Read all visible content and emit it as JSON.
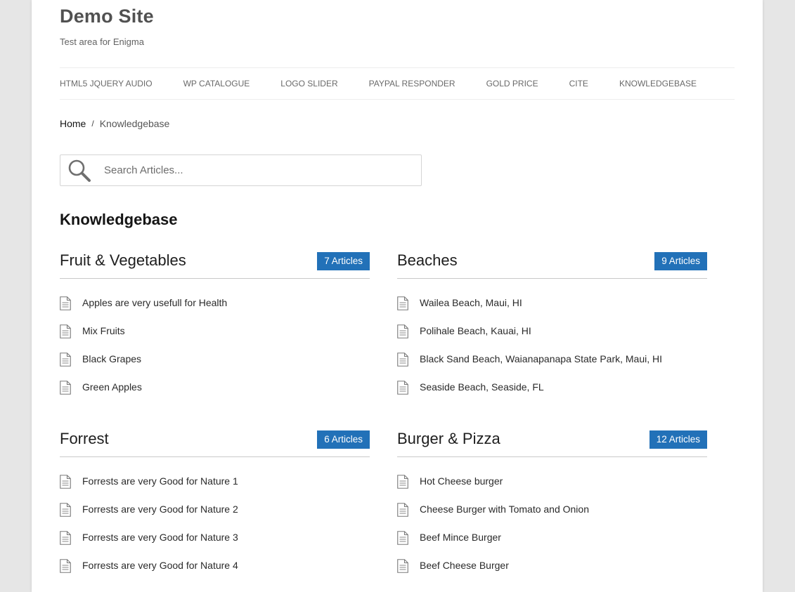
{
  "site": {
    "title": "Demo Site",
    "tagline": "Test area for Enigma"
  },
  "nav": [
    "HTML5 JQUERY AUDIO",
    "WP CATALOGUE",
    "LOGO SLIDER",
    "PAYPAL RESPONDER",
    "GOLD PRICE",
    "CITE",
    "KNOWLEDGEBASE"
  ],
  "breadcrumb": {
    "home": "Home",
    "separator": "/",
    "current": "Knowledgebase"
  },
  "search": {
    "placeholder": "Search Articles..."
  },
  "heading": "Knowledgebase",
  "colors": {
    "badge": "#2271b8",
    "text": "#2a2a2a"
  },
  "categories": [
    {
      "title": "Fruit & Vegetables",
      "count": "7 Articles",
      "articles": [
        "Apples are very usefull for Health",
        "Mix Fruits",
        "Black Grapes",
        "Green Apples"
      ]
    },
    {
      "title": "Beaches",
      "count": "9 Articles",
      "articles": [
        "Wailea Beach, Maui, HI",
        "Polihale Beach, Kauai, HI",
        "Black Sand Beach, Waianapanapa State Park, Maui, HI",
        "Seaside Beach, Seaside, FL"
      ]
    },
    {
      "title": "Forrest",
      "count": "6 Articles",
      "articles": [
        "Forrests are very Good for Nature 1",
        "Forrests are very Good for Nature 2",
        "Forrests are very Good for Nature 3",
        "Forrests are very Good for Nature 4"
      ]
    },
    {
      "title": "Burger & Pizza",
      "count": "12 Articles",
      "articles": [
        "Hot Cheese burger",
        "Cheese Burger with Tomato and Onion",
        "Beef Mince Burger",
        "Beef Cheese Burger"
      ]
    }
  ]
}
